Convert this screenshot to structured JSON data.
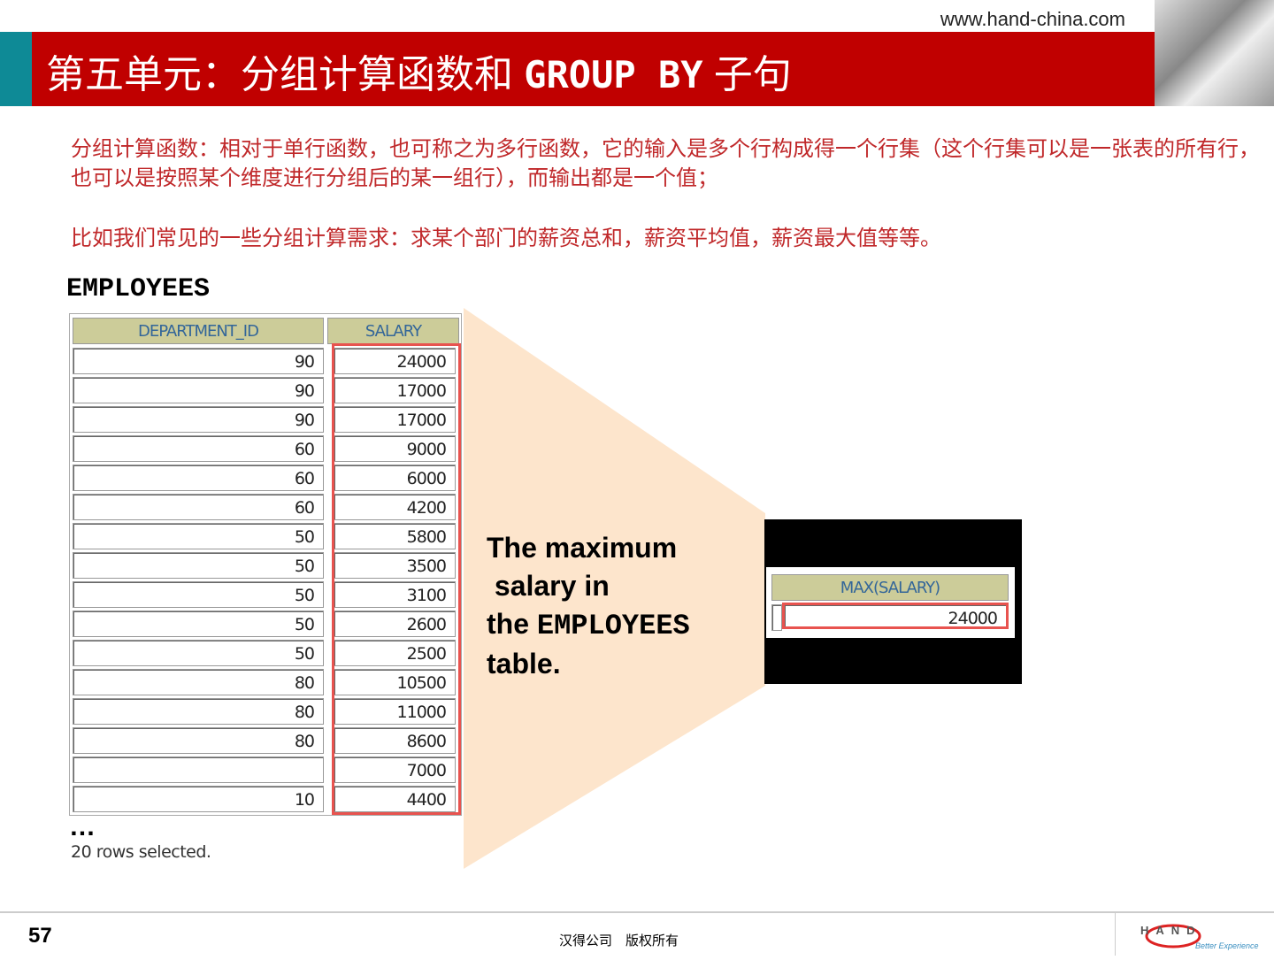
{
  "header": {
    "url": "www.hand-china.com",
    "title_prefix": "第五单元：分组计算函数和 ",
    "title_code": "GROUP  BY",
    "title_suffix": " 子句"
  },
  "body": {
    "para1": "分组计算函数：相对于单行函数，也可称之为多行函数，它的输入是多个行构成得一个行集（这个行集可以是一张表的所有行，也可以是按照某个维度进行分组后的某一组行），而输出都是一个值；",
    "para2": "比如我们常见的一些分组计算需求：求某个部门的薪资总和，薪资平均值，薪资最大值等等。"
  },
  "table": {
    "name": "EMPLOYEES",
    "columns": [
      "DEPARTMENT_ID",
      "SALARY"
    ],
    "rows": [
      [
        "90",
        "24000"
      ],
      [
        "90",
        "17000"
      ],
      [
        "90",
        "17000"
      ],
      [
        "60",
        "9000"
      ],
      [
        "60",
        "6000"
      ],
      [
        "60",
        "4200"
      ],
      [
        "50",
        "5800"
      ],
      [
        "50",
        "3500"
      ],
      [
        "50",
        "3100"
      ],
      [
        "50",
        "2600"
      ],
      [
        "50",
        "2500"
      ],
      [
        "80",
        "10500"
      ],
      [
        "80",
        "11000"
      ],
      [
        "80",
        "8600"
      ],
      [
        "",
        "7000"
      ],
      [
        "10",
        "4400"
      ]
    ],
    "ellipsis": "…",
    "footer": "20 rows selected."
  },
  "caption": {
    "l1": "The maximum",
    "l2": " salary in",
    "l3a": "the ",
    "l3b": "EMPLOYEES",
    "l4": "table."
  },
  "result": {
    "column": "MAX(SALARY)",
    "value": "24000"
  },
  "footer": {
    "page": "57",
    "copyright": "汉得公司　版权所有",
    "logo": "HAND",
    "tagline": "Better Experience"
  },
  "colors": {
    "brand_red": "#C00000",
    "teal": "#0E8A96",
    "funnel": "#FDE5CC"
  }
}
